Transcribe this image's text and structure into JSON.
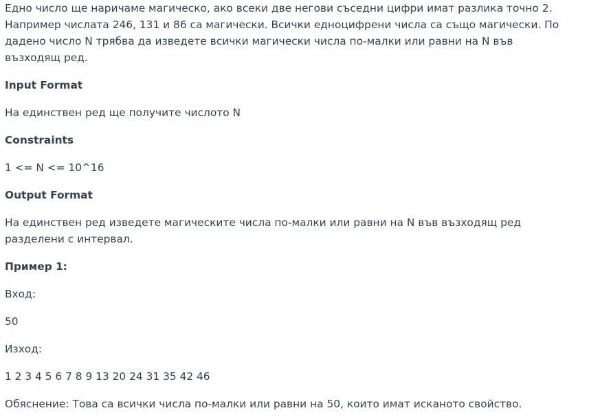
{
  "statement": {
    "intro": "Едно число ще наричаме магическо, ако всеки две негови съседни цифри имат разлика точно 2. Например числата 246, 131 и 86 са магически. Всички едноцифрени числа са също магически. По дадено число N трябва да изведете всички магически числа по-малки или равни на N във възходящ ред."
  },
  "input_format": {
    "heading": "Input Format",
    "text": "На единствен ред ще получите числото N"
  },
  "constraints": {
    "heading": "Constraints",
    "text": "1 <= N <= 10^16"
  },
  "output_format": {
    "heading": "Output Format",
    "text": "На единствен ред изведете магическите числа по-малки или равни на N във възходящ ред разделени с интервал."
  },
  "example": {
    "heading": "Пример 1:",
    "input_label": "Вход:",
    "input_value": "50",
    "output_label": "Изход:",
    "output_value": "1 2 3 4 5 6 7 8 9 13 20 24 31 35 42 46",
    "explanation": "Обяснение: Това са всички числа по-малки или равни на 50, които имат исканото свойство."
  }
}
